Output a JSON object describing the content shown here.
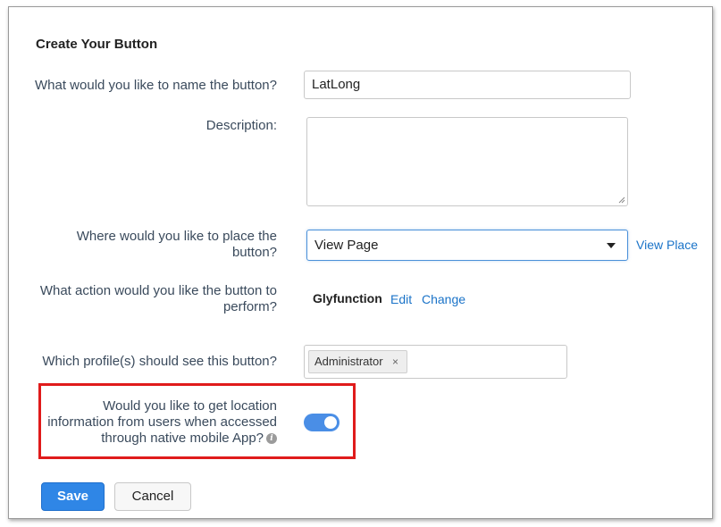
{
  "page_title": "Create Your Button",
  "fields": {
    "name": {
      "label": "What would you like to name the button?",
      "value": "LatLong"
    },
    "description": {
      "label": "Description:",
      "value": ""
    },
    "placement": {
      "label_line1": "Where would you like to place the",
      "label_line2": "button?",
      "selected": "View Page",
      "link": "View Place"
    },
    "action": {
      "label_line1": "What action would you like the button to",
      "label_line2": "perform?",
      "function_name": "Glyfunction",
      "edit_link": "Edit",
      "change_link": "Change"
    },
    "profiles": {
      "label": "Which profile(s) should see this button?",
      "tags": [
        "Administrator"
      ],
      "remove_symbol": "×"
    },
    "location": {
      "label_line1": "Would you like to get location",
      "label_line2": "information from users when accessed",
      "label_line3": "through native mobile App?",
      "enabled": true,
      "info_icon_glyph": "i"
    }
  },
  "buttons": {
    "save": "Save",
    "cancel": "Cancel"
  },
  "colors": {
    "accent": "#2f86e6",
    "highlight": "#e01b1b",
    "toggle_on": "#4a8ee6",
    "link": "#1a73c8"
  },
  "icons": {
    "dropdown": "caret-down-icon",
    "info": "info-icon",
    "remove": "close-icon"
  }
}
